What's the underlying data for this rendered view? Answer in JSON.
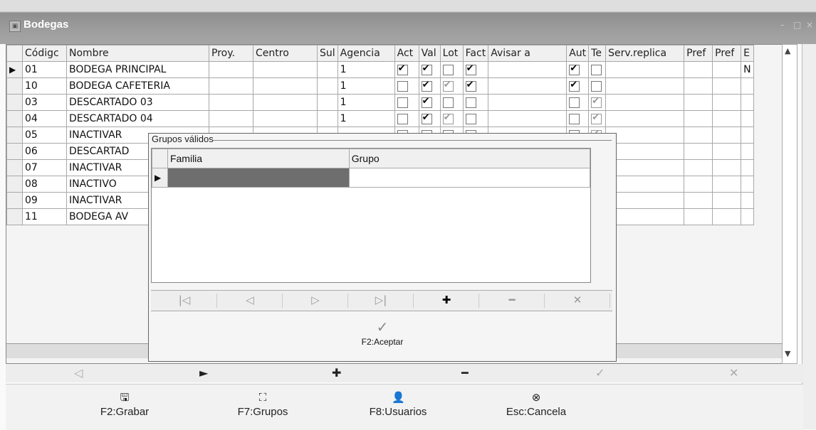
{
  "window": {
    "title": "Bodegas",
    "icon": "app-icon"
  },
  "grid": {
    "columns": [
      "Códigc",
      "Nombre",
      "Proy.",
      "Centro",
      "Sul",
      "Agencia",
      "Act",
      "Val",
      "Lot",
      "Fact",
      "Avisar a",
      "Aut",
      "Te",
      "Serv.replica",
      "Pref",
      "Pref",
      "E"
    ],
    "rows": [
      {
        "codigo": "01",
        "nombre": "BODEGA PRINCIPAL",
        "agencia": "1",
        "act": true,
        "val": true,
        "lot": false,
        "fact": true,
        "aut": true,
        "te": false,
        "e": "N",
        "lot_gray": false,
        "te_gray": false
      },
      {
        "codigo": "10",
        "nombre": "BODEGA CAFETERIA",
        "agencia": "1",
        "act": false,
        "val": true,
        "lot": true,
        "fact": true,
        "aut": true,
        "te": false,
        "e": "",
        "lot_gray": true,
        "te_gray": false
      },
      {
        "codigo": "03",
        "nombre": "DESCARTADO 03",
        "agencia": "1",
        "act": false,
        "val": true,
        "lot": false,
        "fact": false,
        "aut": false,
        "te": true,
        "e": "",
        "lot_gray": false,
        "te_gray": true
      },
      {
        "codigo": "04",
        "nombre": "DESCARTADO 04",
        "agencia": "1",
        "act": false,
        "val": true,
        "lot": true,
        "fact": false,
        "aut": false,
        "te": true,
        "e": "",
        "lot_gray": true,
        "te_gray": true
      },
      {
        "codigo": "05",
        "nombre": "INACTIVAR",
        "agencia": "",
        "act": false,
        "val": false,
        "lot": false,
        "fact": false,
        "aut": false,
        "te": true,
        "e": "",
        "lot_gray": false,
        "te_gray": true
      },
      {
        "codigo": "06",
        "nombre": "DESCARTAD",
        "agencia": "",
        "act": false,
        "val": false,
        "lot": false,
        "fact": false,
        "aut": false,
        "te": true,
        "e": "",
        "lot_gray": false,
        "te_gray": true
      },
      {
        "codigo": "07",
        "nombre": "INACTIVAR",
        "agencia": "",
        "act": false,
        "val": false,
        "lot": false,
        "fact": false,
        "aut": false,
        "te": true,
        "e": "",
        "lot_gray": false,
        "te_gray": true
      },
      {
        "codigo": "08",
        "nombre": "INACTIVO",
        "agencia": "",
        "act": false,
        "val": false,
        "lot": false,
        "fact": false,
        "aut": false,
        "te": true,
        "e": "",
        "lot_gray": false,
        "te_gray": true
      },
      {
        "codigo": "09",
        "nombre": "INACTIVAR",
        "agencia": "",
        "act": false,
        "val": false,
        "lot": false,
        "fact": false,
        "aut": false,
        "te": true,
        "e": "",
        "lot_gray": false,
        "te_gray": true
      },
      {
        "codigo": "11",
        "nombre": "BODEGA AV",
        "agencia": "",
        "act": false,
        "val": false,
        "lot": false,
        "fact": false,
        "aut": false,
        "te": true,
        "e": "",
        "lot_gray": false,
        "te_gray": true
      }
    ]
  },
  "navbar": {
    "items": [
      {
        "icon": "prior-icon",
        "glyph": "◁",
        "enabled": false
      },
      {
        "icon": "next-icon",
        "glyph": "►",
        "enabled": true
      },
      {
        "icon": "insert-icon",
        "glyph": "✚",
        "enabled": true
      },
      {
        "icon": "delete-icon",
        "glyph": "━",
        "enabled": true
      },
      {
        "icon": "post-icon",
        "glyph": "✓",
        "enabled": false
      },
      {
        "icon": "cancel-edit-icon",
        "glyph": "✕",
        "enabled": false
      }
    ]
  },
  "buttons": [
    {
      "label": "F2:Grabar",
      "icon": "save-icon",
      "glyph": "🖫"
    },
    {
      "label": "F7:Grupos",
      "icon": "groups-icon",
      "glyph": "⛶"
    },
    {
      "label": "F8:Usuarios",
      "icon": "users-icon",
      "glyph": "👤"
    },
    {
      "label": "Esc:Cancela",
      "icon": "cancel-icon",
      "glyph": "⊗"
    }
  ],
  "dialog": {
    "title": "Grupos válidos",
    "columns": [
      "Familia",
      "Grupo"
    ],
    "nav": [
      "|◁",
      "◁",
      "▷",
      "▷|",
      "✚",
      "━",
      "✕"
    ],
    "accept_label": "F2:Aceptar",
    "accept_icon": "check-icon"
  }
}
